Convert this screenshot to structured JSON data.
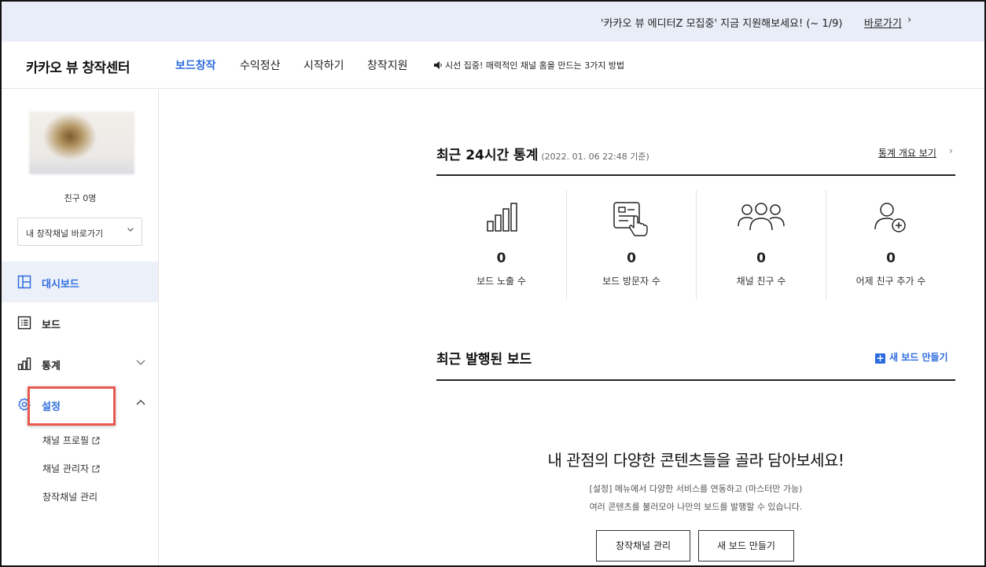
{
  "banner": {
    "text": "'카카오 뷰 에디터Z 모집중' 지금 지원해보세요! (~ 1/9)",
    "link": "바로가기",
    "chevron": "›"
  },
  "header": {
    "logo": "카카오 뷰 창작센터",
    "nav": [
      "보드창작",
      "수익정산",
      "시작하기",
      "창작지원"
    ],
    "active_nav": "보드창작",
    "notice": "시선 집중! 매력적인 채널 홈을 만드는 3가지 방법"
  },
  "sidebar": {
    "friends": "친구 0명",
    "channel_select": "내 창작채널 바로가기",
    "menu": [
      {
        "label": "대시보드",
        "icon": "dashboard-icon",
        "active": true
      },
      {
        "label": "보드",
        "icon": "list-icon"
      },
      {
        "label": "통계",
        "icon": "bar-chart-icon",
        "chevron": "down"
      },
      {
        "label": "설정",
        "icon": "gear-icon",
        "chevron": "up"
      }
    ],
    "submenu": [
      {
        "label": "채널 프로필",
        "external": true
      },
      {
        "label": "채널 관리자",
        "external": true
      },
      {
        "label": "창작채널 관리",
        "external": false
      }
    ]
  },
  "stats": {
    "title": "최근 24시간 통계",
    "subtitle": "(2022. 01. 06 22:48 기준)",
    "link": "통계 개요 보기",
    "items": [
      {
        "value": "0",
        "label": "보드 노출 수",
        "icon": "bar-chart-icon"
      },
      {
        "value": "0",
        "label": "보드 방문자 수",
        "icon": "board-click-icon"
      },
      {
        "value": "0",
        "label": "채널 친구 수",
        "icon": "group-icon"
      },
      {
        "value": "0",
        "label": "어제 친구 추가 수",
        "icon": "add-user-icon"
      }
    ]
  },
  "recent": {
    "title": "최근 발행된 보드",
    "new_board": "새 보드 만들기",
    "empty_title": "내 관점의 다양한 콘텐츠들을 골라 담아보세요!",
    "empty_desc_1": "[설정] 메뉴에서 다양한 서비스를 연동하고 (마스터만 가능)",
    "empty_desc_2": "여러 콘텐츠를 불러모아 나만의 보드를 발행할 수 있습니다.",
    "btn_channel": "창작채널 관리",
    "btn_new": "새 보드 만들기"
  },
  "colors": {
    "accent": "#2d6cdf",
    "banner_bg": "#e9edf7",
    "highlight": "#e85a4f"
  }
}
